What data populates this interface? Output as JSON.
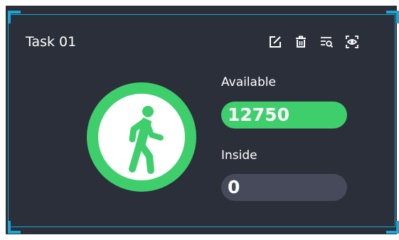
{
  "task": {
    "title": "Task 01"
  },
  "toolbar": {
    "icons": [
      "edit-icon",
      "delete-icon",
      "search-list-icon",
      "view-icon"
    ]
  },
  "stats": {
    "available_label": "Available",
    "available_value": "12750",
    "inside_label": "Inside",
    "inside_value": "0"
  },
  "colors": {
    "background": "#2b2f3a",
    "accent_border": "#19a8d6",
    "available_green": "#3ecf6c",
    "inside_pill": "#464a5a",
    "text": "#ffffff"
  }
}
